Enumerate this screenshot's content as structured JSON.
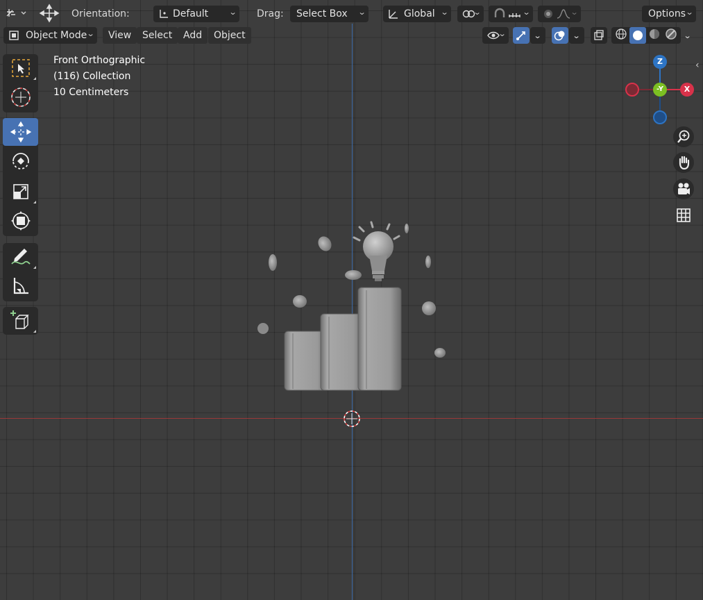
{
  "header": {
    "orientation_label": "Orientation:",
    "orientation_value": "Default",
    "drag_label": "Drag:",
    "drag_value": "Select Box",
    "transform_space": "Global",
    "options_label": "Options"
  },
  "toolbar2": {
    "mode": "Object Mode",
    "menus": [
      "View",
      "Select",
      "Add",
      "Object"
    ]
  },
  "viewport": {
    "view_name": "Front Orthographic",
    "collection": "(116) Collection",
    "scale": "10 Centimeters"
  },
  "gizmo": {
    "z_label": "Z",
    "y_label": "-Y",
    "x_label": "X",
    "colors": {
      "x": "#d8324a",
      "y": "#7cbf22",
      "z": "#2d74c4",
      "x_neg": "#7a2a34",
      "z_neg": "#1f4e87"
    }
  },
  "left_tools": [
    "select-box-icon",
    "cursor-icon",
    "move-icon",
    "rotate-icon",
    "scale-icon",
    "transform-icon",
    "annotate-icon",
    "measure-icon",
    "add-cube-icon"
  ],
  "right_nav": [
    "zoom-icon",
    "hand-icon",
    "camera-icon",
    "grid-icon"
  ],
  "colors": {
    "accent": "#4772b3",
    "background": "#3d3d3d",
    "axis_x": "#9a3838",
    "axis_z": "#3b6aa8"
  }
}
